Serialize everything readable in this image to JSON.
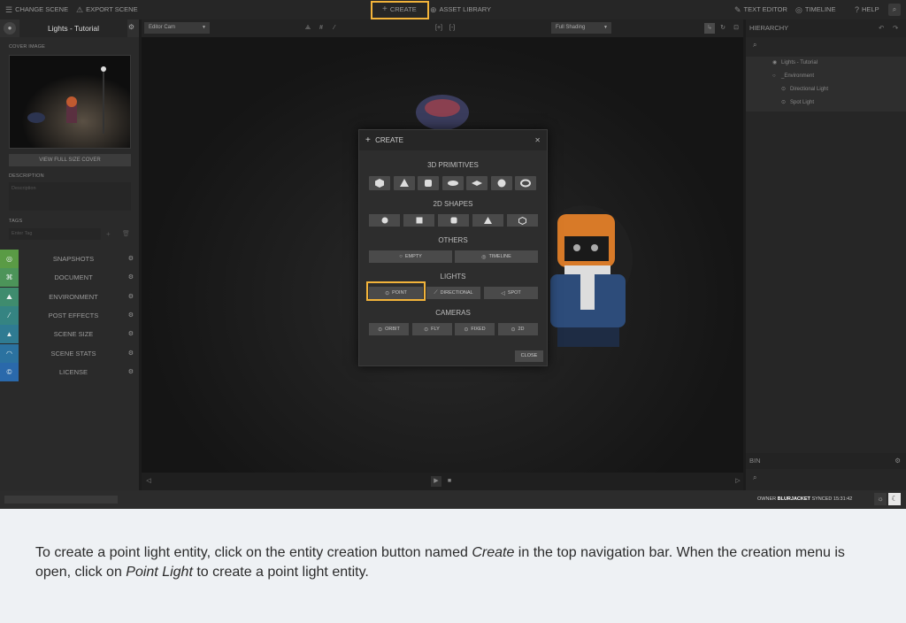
{
  "topbar": {
    "change_scene": "CHANGE SCENE",
    "export_scene": "EXPORT SCENE",
    "create": "CREATE",
    "asset_library": "ASSET LIBRARY",
    "text_editor": "TEXT EDITOR",
    "timeline": "TIMELINE",
    "help": "HELP"
  },
  "left_panel": {
    "project_title": "Lights - Tutorial",
    "cover_image_label": "COVER IMAGE",
    "view_full_size_cover": "VIEW FULL SIZE COVER",
    "description_label": "DESCRIPTION",
    "description_placeholder": "Description",
    "tags_label": "TAGS",
    "tag_placeholder": "Enter Tag",
    "sections": [
      {
        "label": "SNAPSHOTS",
        "color": "#5a9b45",
        "icon": "camera-icon"
      },
      {
        "label": "DOCUMENT",
        "color": "#4c9459",
        "icon": "document-icon"
      },
      {
        "label": "ENVIRONMENT",
        "color": "#3f8c6e",
        "icon": "environment-icon"
      },
      {
        "label": "POST EFFECTS",
        "color": "#358482",
        "icon": "wand-icon"
      },
      {
        "label": "SCENE SIZE",
        "color": "#2f7b92",
        "icon": "weight-icon"
      },
      {
        "label": "SCENE STATS",
        "color": "#2b72a0",
        "icon": "gauge-icon"
      },
      {
        "label": "LICENSE",
        "color": "#2a69ab",
        "icon": "copyright-icon"
      }
    ]
  },
  "viewport": {
    "camera_select": "Editor Cam",
    "shading_select": "Full Shading"
  },
  "right_panel": {
    "hierarchy_title": "HIERARCHY",
    "hierarchy_items": [
      {
        "label": "Lights - Tutorial"
      },
      {
        "label": "_Environment"
      },
      {
        "label": "Directional Light"
      },
      {
        "label": "Spot Light"
      }
    ],
    "bin_title": "BIN"
  },
  "status": {
    "progress_text": "",
    "owner_label": "OWNER",
    "owner_name": "BLURJACKET",
    "synced_label": "SYNCED 15:31:42"
  },
  "dialog": {
    "title": "CREATE",
    "sections": {
      "primitives": "3D PRIMITIVES",
      "shapes2d": "2D SHAPES",
      "others": "OTHERS",
      "lights": "LIGHTS",
      "cameras": "CAMERAS"
    },
    "others": [
      "EMPTY",
      "TIMELINE"
    ],
    "lights": [
      "POINT",
      "DIRECTIONAL",
      "SPOT"
    ],
    "cameras": [
      "ORBIT",
      "FLY",
      "FIXED",
      "2D"
    ],
    "close": "CLOSE"
  },
  "caption": {
    "p1": "To create a point light entity, click on the entity creation button named ",
    "create": "Create",
    "p2": " in the top navigation bar. When the creation menu is open, click on ",
    "point_light": "Point Light",
    "p3": " to create a point light entity."
  }
}
